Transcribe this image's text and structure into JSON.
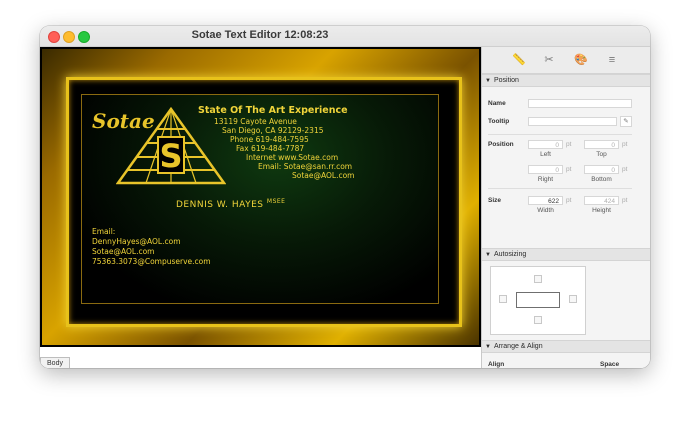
{
  "window": {
    "title": "Sotae Text Editor 12:08:23"
  },
  "card": {
    "brand": "Sotae",
    "tagline": "State Of The Art Experience",
    "address_lines": [
      "13119 Cayote Avenue",
      "San Diego, CA  92129-2315",
      "Phone 619-484-7595",
      "Fax 619-484-7787",
      "Internet  www.Sotae.com",
      "Email: Sotae@san.rr.com",
      "Sotae@AOL.com"
    ],
    "name": "DENNIS W. HAYES",
    "name_suffix": "MSEE",
    "email_lines": [
      "Email:",
      "DennyHayes@AOL.com",
      "Sotae@AOL.com",
      "75363.3073@Compuserve.com"
    ]
  },
  "editor": {
    "body_tab": "Body"
  },
  "inspector": {
    "tabs": [
      {
        "icon": "ruler-icon",
        "glyph": "📏"
      },
      {
        "icon": "tools-icon",
        "glyph": "✂"
      },
      {
        "icon": "palette-icon",
        "glyph": "🎨"
      },
      {
        "icon": "database-icon",
        "glyph": "≡"
      }
    ],
    "position_section": "Position",
    "name_label": "Name",
    "tooltip_label": "Tooltip",
    "position_label": "Position",
    "left_value": "0",
    "top_value": "0",
    "right_value": "0",
    "bottom_value": "0",
    "unit": "pt",
    "left_label": "Left",
    "top_label": "Top",
    "right_label": "Right",
    "bottom_label": "Bottom",
    "size_label": "Size",
    "width_value": "622",
    "height_value": "424",
    "width_label": "Width",
    "height_label": "Height",
    "autosizing_section": "Autosizing",
    "arrange_section": "Arrange & Align",
    "align_label": "Align",
    "space_label": "Space"
  },
  "colors": {
    "gold": "#f0d43a",
    "frame": "#d8a300",
    "inspector_bg": "#f4f4f4"
  }
}
